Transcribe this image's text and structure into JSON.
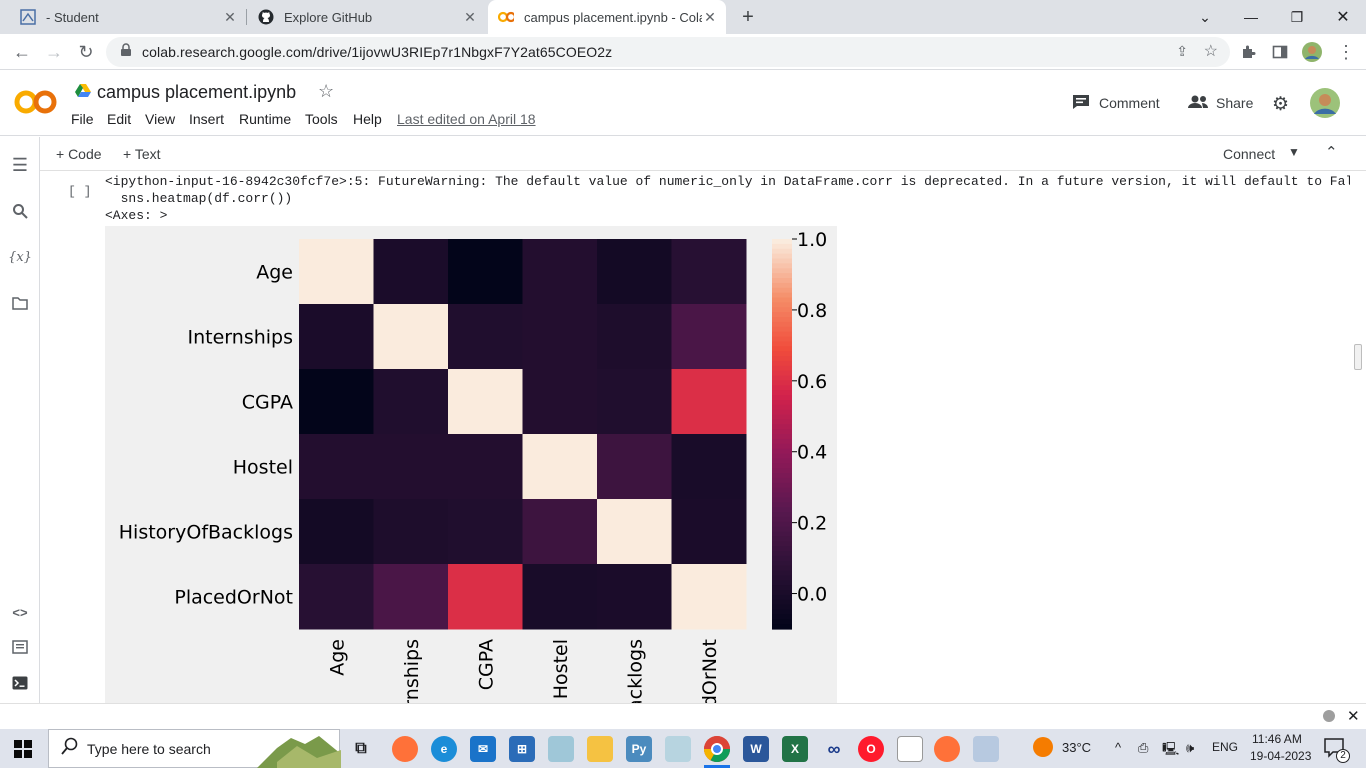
{
  "browser": {
    "tabs": [
      {
        "title": "- Student",
        "icon": "student-portal-icon"
      },
      {
        "title": "Explore GitHub",
        "icon": "github-icon"
      },
      {
        "title": "campus placement.ipynb - Colab",
        "icon": "colab-icon"
      }
    ],
    "new_tab_label": "+",
    "url": "colab.research.google.com/drive/1ijovwU3RIEp7r1NbgxF7Y2at65COEO2z"
  },
  "colab": {
    "logo": "CO",
    "notebook_title": "campus placement.ipynb",
    "menu": [
      "File",
      "Edit",
      "View",
      "Insert",
      "Runtime",
      "Tools",
      "Help"
    ],
    "last_edited": "Last edited on April 18",
    "comment_label": "Comment",
    "share_label": "Share",
    "add_code_label": "+ Code",
    "add_text_label": "+ Text",
    "connect_label": "Connect"
  },
  "cell": {
    "exec_marker": "[ ]",
    "output_lines": [
      "<ipython-input-16-8942c30fcf7e>:5: FutureWarning: The default value of numeric_only in DataFrame.corr is deprecated. In a future version, it will default to False",
      "  sns.heatmap(df.corr())",
      "<Axes: >"
    ]
  },
  "chart_data": {
    "type": "heatmap",
    "row_labels": [
      "Age",
      "Internships",
      "CGPA",
      "Hostel",
      "HistoryOfBacklogs",
      "PlacedOrNot"
    ],
    "col_labels_visible": [
      "Age",
      "rnships",
      "CGPA",
      "Hostel",
      "acklogs",
      "dOrNot"
    ],
    "values": [
      [
        1.0,
        0.0,
        -0.1,
        0.03,
        -0.03,
        0.05
      ],
      [
        0.0,
        1.0,
        0.02,
        0.03,
        0.01,
        0.18
      ],
      [
        -0.1,
        0.02,
        1.0,
        0.03,
        0.02,
        0.6
      ],
      [
        0.03,
        0.03,
        0.03,
        1.0,
        0.13,
        -0.01
      ],
      [
        -0.03,
        0.01,
        0.02,
        0.13,
        1.0,
        0.0
      ],
      [
        0.05,
        0.18,
        0.6,
        -0.01,
        0.0,
        1.0
      ]
    ],
    "colorbar_ticks": [
      "1.0",
      "0.8",
      "0.6",
      "0.4",
      "0.2",
      "0.0"
    ],
    "vmin": -0.1,
    "vmax": 1.0,
    "colormap": "rocket"
  },
  "taskbar": {
    "search_placeholder": "Type here to search",
    "weather": "33°C",
    "lang": "ENG",
    "time": "11:46 AM",
    "date": "19-04-2023",
    "notifications": "2"
  }
}
